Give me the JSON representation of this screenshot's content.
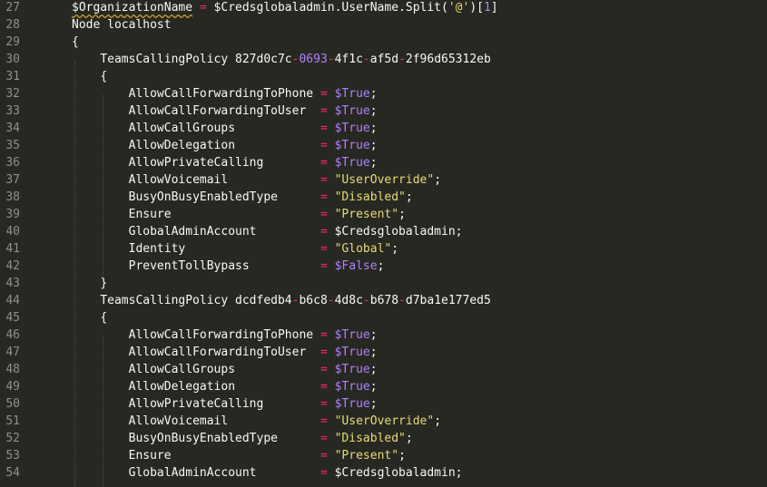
{
  "colors": {
    "background": "#272822",
    "line_number": "#8f908a",
    "text": "#f8f8f2",
    "operator": "#f92672",
    "string": "#e6db74",
    "boolean": "#ae81ff",
    "warning_squiggle": "#c9a227"
  },
  "lines": [
    {
      "n": "27",
      "indent": "",
      "tokens": [
        {
          "t": "$OrganizationName",
          "c": "var",
          "w": true
        },
        {
          "t": " ",
          "c": "txt"
        },
        {
          "t": "=",
          "c": "op"
        },
        {
          "t": " $Credsglobaladmin.UserName.Split(",
          "c": "txt"
        },
        {
          "t": "'@'",
          "c": "str"
        },
        {
          "t": ")[",
          "c": "txt"
        },
        {
          "t": "1",
          "c": "num"
        },
        {
          "t": "]",
          "c": "txt"
        }
      ]
    },
    {
      "n": "28",
      "indent": "",
      "tokens": [
        {
          "t": "Node localhost",
          "c": "txt"
        }
      ]
    },
    {
      "n": "29",
      "indent": "",
      "tokens": [
        {
          "t": "{",
          "c": "txt"
        }
      ]
    },
    {
      "n": "30",
      "indent": "    ",
      "tokens": [
        {
          "t": "TeamsCallingPolicy 827d0c7c",
          "c": "txt"
        },
        {
          "t": "-",
          "c": "op"
        },
        {
          "t": "0693",
          "c": "num"
        },
        {
          "t": "-",
          "c": "op"
        },
        {
          "t": "4f1c",
          "c": "txt"
        },
        {
          "t": "-",
          "c": "op"
        },
        {
          "t": "af5d",
          "c": "txt"
        },
        {
          "t": "-",
          "c": "op"
        },
        {
          "t": "2f96d65312eb",
          "c": "txt"
        }
      ]
    },
    {
      "n": "31",
      "indent": "    ",
      "tokens": [
        {
          "t": "{",
          "c": "txt"
        }
      ]
    },
    {
      "n": "32",
      "indent": "        ",
      "tokens": [
        {
          "t": "AllowCallForwardingToPhone ",
          "c": "txt"
        },
        {
          "t": "=",
          "c": "op"
        },
        {
          "t": " ",
          "c": "txt"
        },
        {
          "t": "$True",
          "c": "bool"
        },
        {
          "t": ";",
          "c": "txt"
        }
      ]
    },
    {
      "n": "33",
      "indent": "        ",
      "tokens": [
        {
          "t": "AllowCallForwardingToUser  ",
          "c": "txt"
        },
        {
          "t": "=",
          "c": "op"
        },
        {
          "t": " ",
          "c": "txt"
        },
        {
          "t": "$True",
          "c": "bool"
        },
        {
          "t": ";",
          "c": "txt"
        }
      ]
    },
    {
      "n": "34",
      "indent": "        ",
      "tokens": [
        {
          "t": "AllowCallGroups            ",
          "c": "txt"
        },
        {
          "t": "=",
          "c": "op"
        },
        {
          "t": " ",
          "c": "txt"
        },
        {
          "t": "$True",
          "c": "bool"
        },
        {
          "t": ";",
          "c": "txt"
        }
      ]
    },
    {
      "n": "35",
      "indent": "        ",
      "tokens": [
        {
          "t": "AllowDelegation            ",
          "c": "txt"
        },
        {
          "t": "=",
          "c": "op"
        },
        {
          "t": " ",
          "c": "txt"
        },
        {
          "t": "$True",
          "c": "bool"
        },
        {
          "t": ";",
          "c": "txt"
        }
      ]
    },
    {
      "n": "36",
      "indent": "        ",
      "tokens": [
        {
          "t": "AllowPrivateCalling        ",
          "c": "txt"
        },
        {
          "t": "=",
          "c": "op"
        },
        {
          "t": " ",
          "c": "txt"
        },
        {
          "t": "$True",
          "c": "bool"
        },
        {
          "t": ";",
          "c": "txt"
        }
      ]
    },
    {
      "n": "37",
      "indent": "        ",
      "tokens": [
        {
          "t": "AllowVoicemail             ",
          "c": "txt"
        },
        {
          "t": "=",
          "c": "op"
        },
        {
          "t": " ",
          "c": "txt"
        },
        {
          "t": "\"UserOverride\"",
          "c": "str"
        },
        {
          "t": ";",
          "c": "txt"
        }
      ]
    },
    {
      "n": "38",
      "indent": "        ",
      "tokens": [
        {
          "t": "BusyOnBusyEnabledType      ",
          "c": "txt"
        },
        {
          "t": "=",
          "c": "op"
        },
        {
          "t": " ",
          "c": "txt"
        },
        {
          "t": "\"Disabled\"",
          "c": "str"
        },
        {
          "t": ";",
          "c": "txt"
        }
      ]
    },
    {
      "n": "39",
      "indent": "        ",
      "tokens": [
        {
          "t": "Ensure                     ",
          "c": "txt"
        },
        {
          "t": "=",
          "c": "op"
        },
        {
          "t": " ",
          "c": "txt"
        },
        {
          "t": "\"Present\"",
          "c": "str"
        },
        {
          "t": ";",
          "c": "txt"
        }
      ]
    },
    {
      "n": "40",
      "indent": "        ",
      "tokens": [
        {
          "t": "GlobalAdminAccount         ",
          "c": "txt"
        },
        {
          "t": "=",
          "c": "op"
        },
        {
          "t": " $Credsglobaladmin;",
          "c": "txt"
        }
      ]
    },
    {
      "n": "41",
      "indent": "        ",
      "tokens": [
        {
          "t": "Identity                   ",
          "c": "txt"
        },
        {
          "t": "=",
          "c": "op"
        },
        {
          "t": " ",
          "c": "txt"
        },
        {
          "t": "\"Global\"",
          "c": "str"
        },
        {
          "t": ";",
          "c": "txt"
        }
      ]
    },
    {
      "n": "42",
      "indent": "        ",
      "tokens": [
        {
          "t": "PreventTollBypass          ",
          "c": "txt"
        },
        {
          "t": "=",
          "c": "op"
        },
        {
          "t": " ",
          "c": "txt"
        },
        {
          "t": "$False",
          "c": "bool"
        },
        {
          "t": ";",
          "c": "txt"
        }
      ]
    },
    {
      "n": "43",
      "indent": "    ",
      "tokens": [
        {
          "t": "}",
          "c": "txt"
        }
      ]
    },
    {
      "n": "44",
      "indent": "    ",
      "tokens": [
        {
          "t": "TeamsCallingPolicy dcdfedb4",
          "c": "txt"
        },
        {
          "t": "-",
          "c": "op"
        },
        {
          "t": "b6c8",
          "c": "txt"
        },
        {
          "t": "-",
          "c": "op"
        },
        {
          "t": "4d8c",
          "c": "txt"
        },
        {
          "t": "-",
          "c": "op"
        },
        {
          "t": "b678",
          "c": "txt"
        },
        {
          "t": "-",
          "c": "op"
        },
        {
          "t": "d7ba1e177ed5",
          "c": "txt"
        }
      ]
    },
    {
      "n": "45",
      "indent": "    ",
      "tokens": [
        {
          "t": "{",
          "c": "txt"
        }
      ]
    },
    {
      "n": "46",
      "indent": "        ",
      "tokens": [
        {
          "t": "AllowCallForwardingToPhone ",
          "c": "txt"
        },
        {
          "t": "=",
          "c": "op"
        },
        {
          "t": " ",
          "c": "txt"
        },
        {
          "t": "$True",
          "c": "bool"
        },
        {
          "t": ";",
          "c": "txt"
        }
      ]
    },
    {
      "n": "47",
      "indent": "        ",
      "tokens": [
        {
          "t": "AllowCallForwardingToUser  ",
          "c": "txt"
        },
        {
          "t": "=",
          "c": "op"
        },
        {
          "t": " ",
          "c": "txt"
        },
        {
          "t": "$True",
          "c": "bool"
        },
        {
          "t": ";",
          "c": "txt"
        }
      ]
    },
    {
      "n": "48",
      "indent": "        ",
      "tokens": [
        {
          "t": "AllowCallGroups            ",
          "c": "txt"
        },
        {
          "t": "=",
          "c": "op"
        },
        {
          "t": " ",
          "c": "txt"
        },
        {
          "t": "$True",
          "c": "bool"
        },
        {
          "t": ";",
          "c": "txt"
        }
      ]
    },
    {
      "n": "49",
      "indent": "        ",
      "tokens": [
        {
          "t": "AllowDelegation            ",
          "c": "txt"
        },
        {
          "t": "=",
          "c": "op"
        },
        {
          "t": " ",
          "c": "txt"
        },
        {
          "t": "$True",
          "c": "bool"
        },
        {
          "t": ";",
          "c": "txt"
        }
      ]
    },
    {
      "n": "50",
      "indent": "        ",
      "tokens": [
        {
          "t": "AllowPrivateCalling        ",
          "c": "txt"
        },
        {
          "t": "=",
          "c": "op"
        },
        {
          "t": " ",
          "c": "txt"
        },
        {
          "t": "$True",
          "c": "bool"
        },
        {
          "t": ";",
          "c": "txt"
        }
      ]
    },
    {
      "n": "51",
      "indent": "        ",
      "tokens": [
        {
          "t": "AllowVoicemail             ",
          "c": "txt"
        },
        {
          "t": "=",
          "c": "op"
        },
        {
          "t": " ",
          "c": "txt"
        },
        {
          "t": "\"UserOverride\"",
          "c": "str"
        },
        {
          "t": ";",
          "c": "txt"
        }
      ]
    },
    {
      "n": "52",
      "indent": "        ",
      "tokens": [
        {
          "t": "BusyOnBusyEnabledType      ",
          "c": "txt"
        },
        {
          "t": "=",
          "c": "op"
        },
        {
          "t": " ",
          "c": "txt"
        },
        {
          "t": "\"Disabled\"",
          "c": "str"
        },
        {
          "t": ";",
          "c": "txt"
        }
      ]
    },
    {
      "n": "53",
      "indent": "        ",
      "tokens": [
        {
          "t": "Ensure                     ",
          "c": "txt"
        },
        {
          "t": "=",
          "c": "op"
        },
        {
          "t": " ",
          "c": "txt"
        },
        {
          "t": "\"Present\"",
          "c": "str"
        },
        {
          "t": ";",
          "c": "txt"
        }
      ]
    },
    {
      "n": "54",
      "indent": "        ",
      "tokens": [
        {
          "t": "GlobalAdminAccount         ",
          "c": "txt"
        },
        {
          "t": "=",
          "c": "op"
        },
        {
          "t": " $Credsglobaladmin;",
          "c": "txt"
        }
      ]
    }
  ]
}
